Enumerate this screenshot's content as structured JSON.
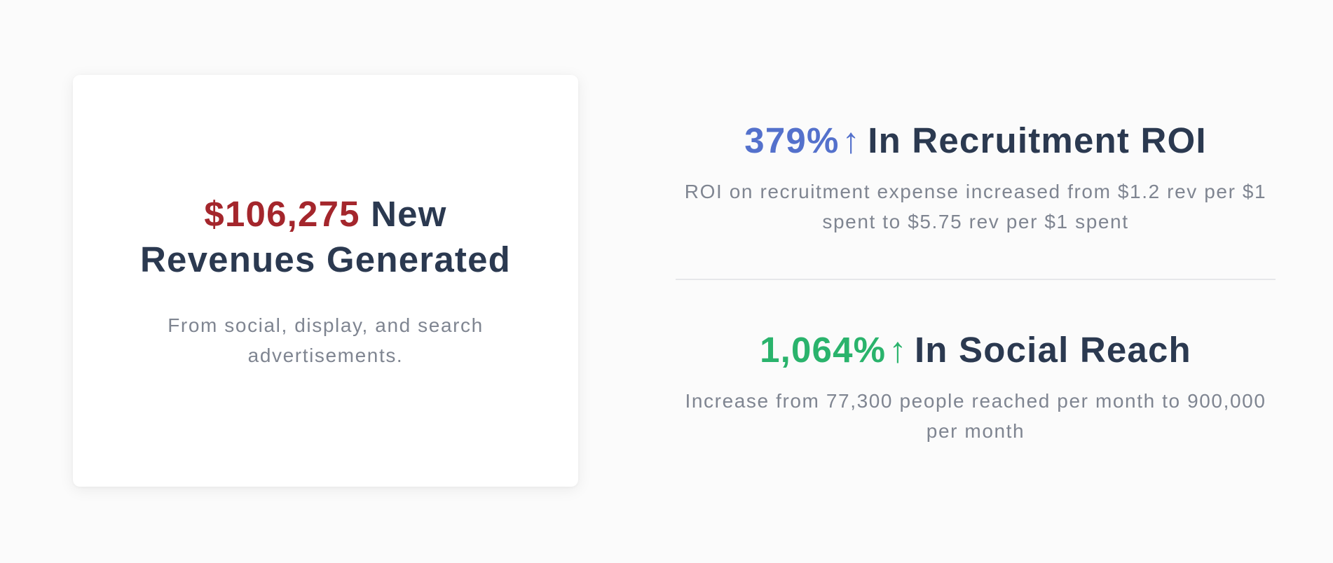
{
  "revenue_card": {
    "amount": "$106,275",
    "headline_rest": "New Revenues Generated",
    "description": "From social, display, and search advertisements."
  },
  "stats": [
    {
      "value": "379%",
      "arrow": "↑",
      "title": "In Recruitment ROI",
      "description": "ROI on recruitment expense increased from $1.2 rev per $1 spent to $5.75 rev per $1 spent",
      "color": "#5471cc"
    },
    {
      "value": "1,064%",
      "arrow": "↑",
      "title": "In Social Reach",
      "description": "Increase from 77,300 people reached per month to 900,000 per month",
      "color": "#2ab36c"
    }
  ],
  "colors": {
    "amount": "#a4262c",
    "heading": "#2b3950",
    "body_text": "#7f8591"
  },
  "icons": {
    "increase": "arrow-up-icon"
  }
}
